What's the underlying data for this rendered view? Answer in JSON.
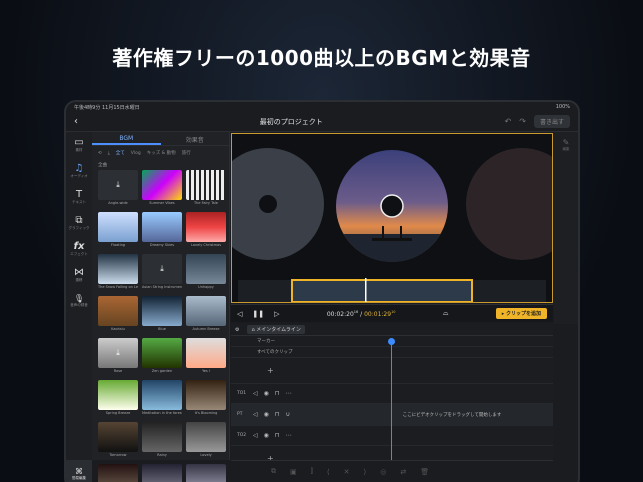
{
  "headline": "著作権フリーの1000曲以上のBGMと効果音",
  "status": {
    "time": "午後4時9分 11月15日水曜日",
    "battery": "100%"
  },
  "project": {
    "title": "最初のプロジェクト",
    "export_label": "書き出す"
  },
  "rail": [
    {
      "icon": "▭",
      "label": "素材"
    },
    {
      "icon": "♫",
      "label": "オーディオ"
    },
    {
      "icon": "T",
      "label": "テキスト"
    },
    {
      "icon": "⧉",
      "label": "グラフィック"
    },
    {
      "icon": "fx",
      "label": "エフェクト"
    },
    {
      "icon": "⋈",
      "label": "遷移"
    },
    {
      "icon": "🎙",
      "label": "音声の録音"
    }
  ],
  "mode_switch": {
    "icon": "⌘",
    "label": "簡易編集"
  },
  "library": {
    "tabs": [
      "BGM",
      "効果音"
    ],
    "filters": [
      "全て",
      "Vlog",
      "キッズ & 動物",
      "旅行"
    ],
    "section": "全曲",
    "tracks": [
      "Angle-wide",
      "Summer Vibes",
      "The Fairy Tale",
      "Floating",
      "Dreamy Skies",
      "Lovely Christmas",
      "The Snow Falling on Leaves",
      "Asian String Instrument",
      "Unhappy",
      "Kaohsiu",
      "Blue",
      "Autumn Breeze",
      "Rose",
      "Zen garden",
      "Yes I",
      "Spring Breeze",
      "Meditation in the forest",
      "It's Blooming",
      "Tomorrow",
      "Rainy",
      "Lovely",
      "Ambient",
      "Night",
      "Calm"
    ]
  },
  "player": {
    "current_time": "00:02:20",
    "current_frames": "16",
    "total_time": "00:01:29",
    "total_frames": "10",
    "add_clip_label": "クリップを追加"
  },
  "right_rail": {
    "icon": "✎",
    "label": "編集"
  },
  "timeline": {
    "main_label": "メインタイムライン",
    "marker_label": "マーカー",
    "all_clips_label": "すべてのクリップ",
    "tracks": [
      "TO1",
      "PT",
      "TO2"
    ],
    "drop_hint": "ここにビデオクリップをドラッグして開始します"
  }
}
